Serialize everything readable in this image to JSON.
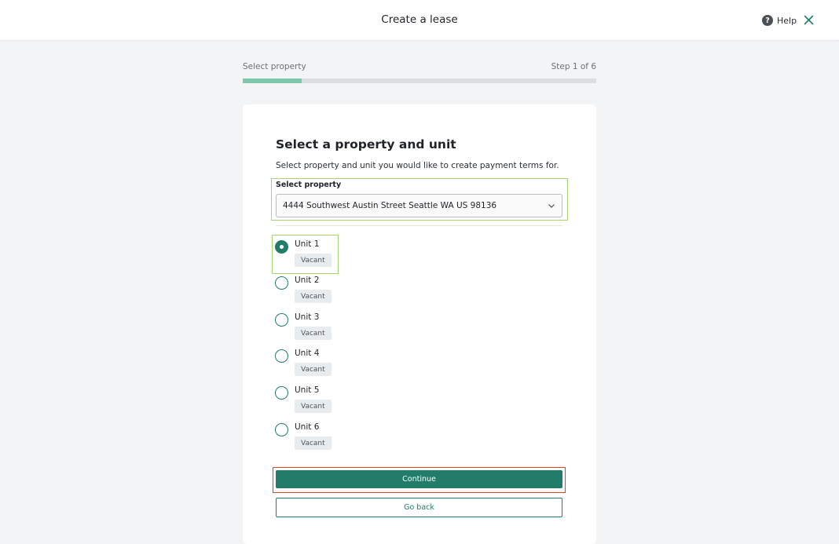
{
  "header": {
    "title": "Create a lease",
    "help_label": "Help"
  },
  "progress": {
    "step_label": "Select property",
    "step_count": "Step 1 of 6",
    "fraction": 0.1667,
    "fill_color": "#7ec7ad"
  },
  "form": {
    "heading": "Select a property and unit",
    "subtext": "Select property and unit you would like to create payment terms for.",
    "property_label": "Select property",
    "property_value": "4444 Southwest Austin Street Seattle WA US 98136"
  },
  "units": [
    {
      "name": "Unit 1",
      "status": "Vacant",
      "selected": true
    },
    {
      "name": "Unit 2",
      "status": "Vacant",
      "selected": false
    },
    {
      "name": "Unit 3",
      "status": "Vacant",
      "selected": false
    },
    {
      "name": "Unit 4",
      "status": "Vacant",
      "selected": false
    },
    {
      "name": "Unit 5",
      "status": "Vacant",
      "selected": false
    },
    {
      "name": "Unit 6",
      "status": "Vacant",
      "selected": false
    }
  ],
  "actions": {
    "continue_label": "Continue",
    "back_label": "Go back"
  },
  "colors": {
    "accent": "#217d69",
    "highlight_green": "#a6d47a",
    "highlight_red": "#e0402d"
  }
}
